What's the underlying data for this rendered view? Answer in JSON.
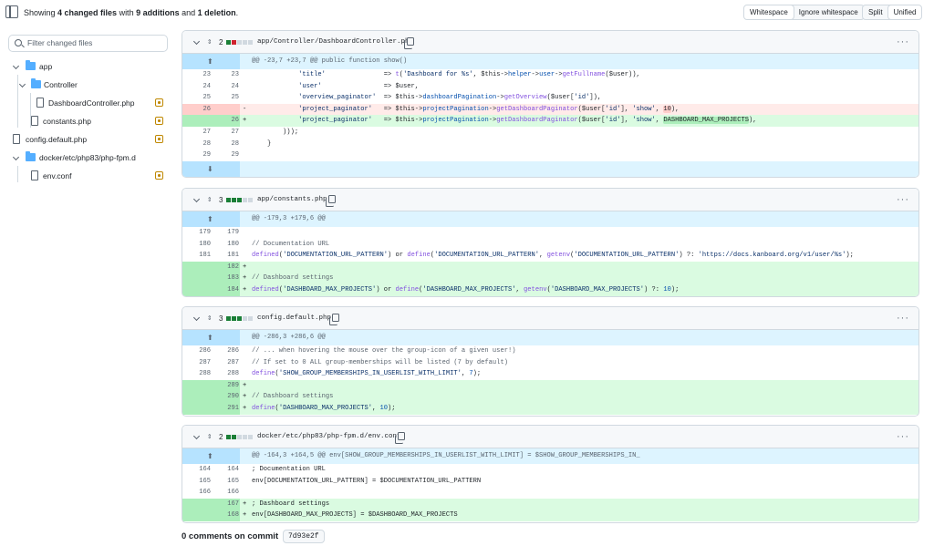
{
  "summary": {
    "prefix": "Showing ",
    "files": "4 changed files",
    "mid": " with ",
    "adds": "9 additions",
    "and": " and ",
    "dels": "1 deletion",
    "end": "."
  },
  "whitespace": {
    "a": "Whitespace",
    "b": "Ignore whitespace"
  },
  "view": {
    "a": "Split",
    "b": "Unified"
  },
  "filter": {
    "placeholder": "Filter changed files"
  },
  "tree": {
    "app": "app",
    "controller": "Controller",
    "dashctl": "DashboardController.php",
    "constants": "constants.php",
    "config": "config.default.php",
    "docker": "docker/etc/php83/php-fpm.d",
    "env": "env.conf"
  },
  "files": [
    {
      "count": "2",
      "name": "app/Controller/DashboardController.php",
      "hunk": "@@ -23,7 +23,7 @@ public function show()"
    },
    {
      "count": "3",
      "name": "app/constants.php",
      "hunk": "@@ -179,3 +179,6 @@"
    },
    {
      "count": "3",
      "name": "config.default.php",
      "hunk": "@@ -286,3 +286,6 @@"
    },
    {
      "count": "2",
      "name": "docker/etc/php83/php-fpm.d/env.conf",
      "hunk": "@@ -164,3 +164,5 @@ env[SHOW_GROUP_MEMBERSHIPS_IN_USERLIST_WITH_LIMIT] = $SHOW_GROUP_MEMBERSHIPS_IN_"
    }
  ],
  "lines": {
    "f1": [
      {
        "o": "23",
        "n": "23",
        "t": "ctx",
        "c": "            'title'               => t('Dashboard for %s', $this->helper->user->getFullname($user)),"
      },
      {
        "o": "24",
        "n": "24",
        "t": "ctx",
        "c": "            'user'                => $user,"
      },
      {
        "o": "25",
        "n": "25",
        "t": "ctx",
        "c": "            'overview_paginator'  => $this->dashboardPagination->getOverview($user['id']),"
      },
      {
        "o": "26",
        "n": "",
        "t": "del",
        "c": "            'project_paginator'   => $this->projectPagination->getDashboardPaginator($user['id'], 'show', 10),"
      },
      {
        "o": "",
        "n": "26",
        "t": "add",
        "c": "            'project_paginator'   => $this->projectPagination->getDashboardPaginator($user['id'], 'show', DASHBOARD_MAX_PROJECTS),"
      },
      {
        "o": "27",
        "n": "27",
        "t": "ctx",
        "c": "        )));"
      },
      {
        "o": "28",
        "n": "28",
        "t": "ctx",
        "c": "    }"
      },
      {
        "o": "29",
        "n": "29",
        "t": "ctx",
        "c": ""
      }
    ],
    "f2": [
      {
        "o": "179",
        "n": "179",
        "t": "ctx",
        "c": ""
      },
      {
        "o": "180",
        "n": "180",
        "t": "ctx",
        "c": "// Documentation URL"
      },
      {
        "o": "181",
        "n": "181",
        "t": "ctx",
        "c": "defined('DOCUMENTATION_URL_PATTERN') or define('DOCUMENTATION_URL_PATTERN', getenv('DOCUMENTATION_URL_PATTERN') ?: 'https://docs.kanboard.org/v1/user/%s');"
      },
      {
        "o": "",
        "n": "182",
        "t": "add",
        "c": ""
      },
      {
        "o": "",
        "n": "183",
        "t": "add",
        "c": "// Dashboard settings"
      },
      {
        "o": "",
        "n": "184",
        "t": "add",
        "c": "defined('DASHBOARD_MAX_PROJECTS') or define('DASHBOARD_MAX_PROJECTS', getenv('DASHBOARD_MAX_PROJECTS') ?: 10);"
      }
    ],
    "f3": [
      {
        "o": "286",
        "n": "286",
        "t": "ctx",
        "c": "// ... when hovering the mouse over the group-icon of a given user!)"
      },
      {
        "o": "287",
        "n": "287",
        "t": "ctx",
        "c": "// If set to 0 ALL group-memberships will be listed (7 by default)"
      },
      {
        "o": "288",
        "n": "288",
        "t": "ctx",
        "c": "define('SHOW_GROUP_MEMBERSHIPS_IN_USERLIST_WITH_LIMIT', 7);"
      },
      {
        "o": "",
        "n": "289",
        "t": "add",
        "c": ""
      },
      {
        "o": "",
        "n": "290",
        "t": "add",
        "c": "// Dashboard settings"
      },
      {
        "o": "",
        "n": "291",
        "t": "add",
        "c": "define('DASHBOARD_MAX_PROJECTS', 10);"
      }
    ],
    "f4": [
      {
        "o": "164",
        "n": "164",
        "t": "ctx",
        "c": "; Documentation URL"
      },
      {
        "o": "165",
        "n": "165",
        "t": "ctx",
        "c": "env[DOCUMENTATION_URL_PATTERN] = $DOCUMENTATION_URL_PATTERN"
      },
      {
        "o": "166",
        "n": "166",
        "t": "ctx",
        "c": ""
      },
      {
        "o": "",
        "n": "167",
        "t": "add",
        "c": "; Dashboard settings"
      },
      {
        "o": "",
        "n": "168",
        "t": "add",
        "c": "env[DASHBOARD_MAX_PROJECTS] = $DASHBOARD_MAX_PROJECTS"
      }
    ]
  },
  "footer": {
    "label": "0 comments on commit",
    "sha": "7d93e2f"
  },
  "colors": {
    "add": "#dafbe1",
    "del": "#ffebe9",
    "hunk": "#ddf4ff",
    "accent": "#0969da"
  }
}
